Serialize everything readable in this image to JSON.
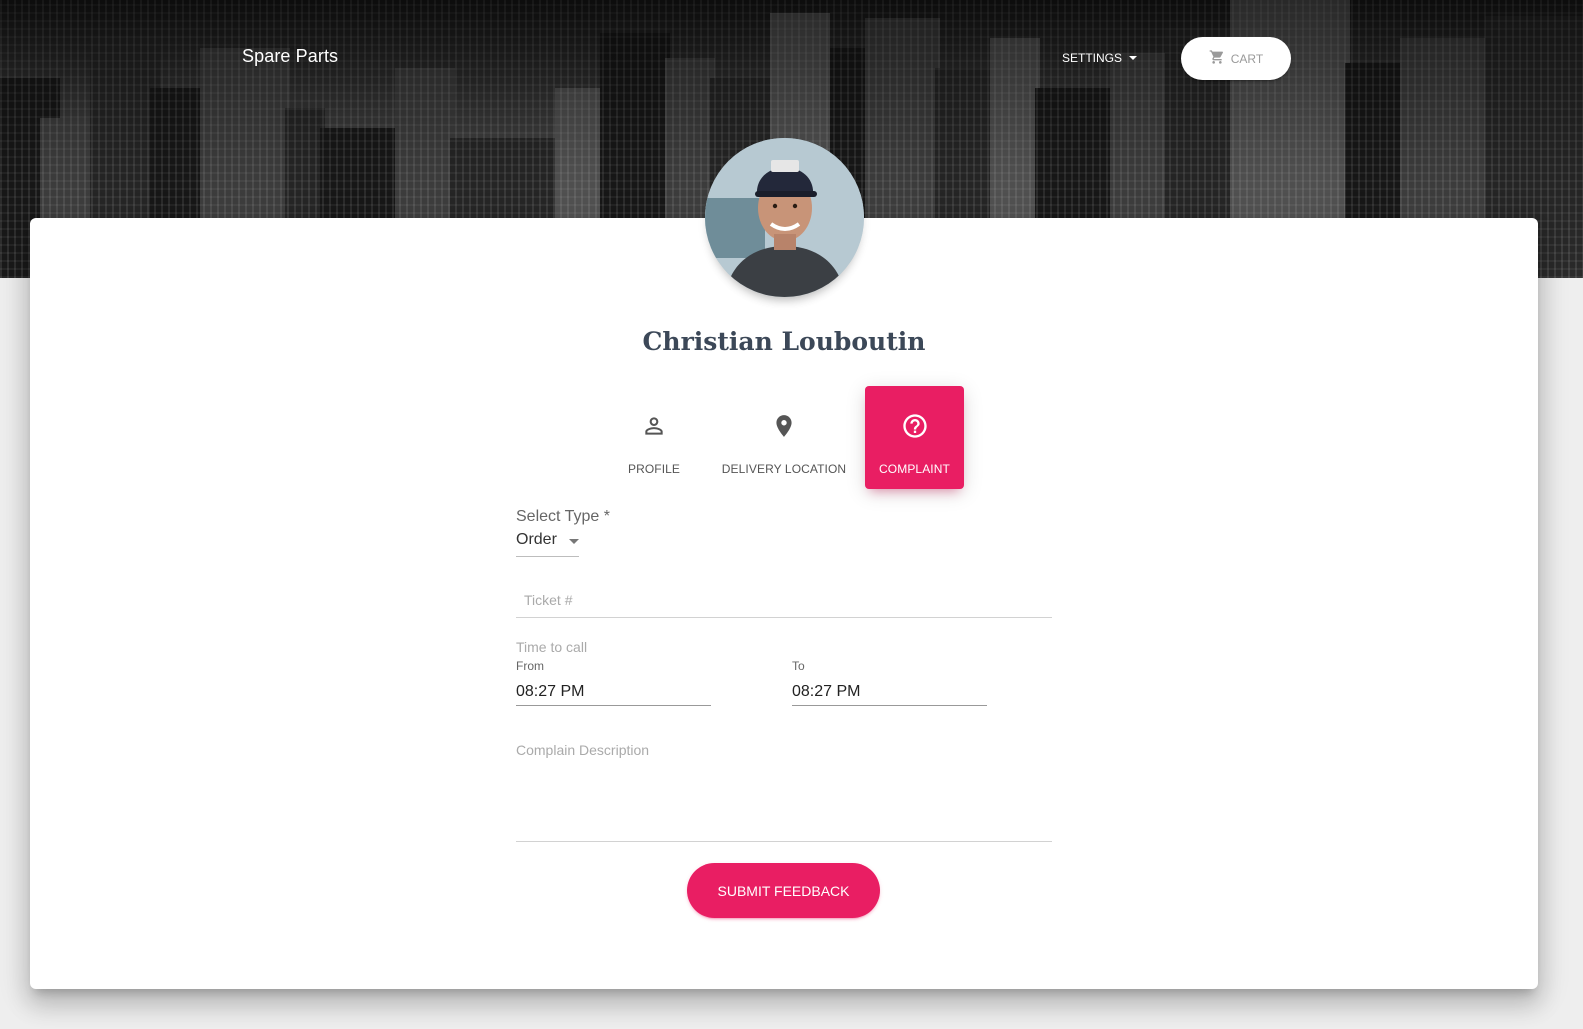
{
  "navbar": {
    "brand": "Spare Parts",
    "settings_label": "SETTINGS",
    "cart_label": "CART"
  },
  "profile": {
    "name": "Christian Louboutin"
  },
  "tabs": [
    {
      "label": "PROFILE",
      "icon": "person-icon",
      "active": false
    },
    {
      "label": "DELIVERY LOCATION",
      "icon": "location-pin-icon",
      "active": false
    },
    {
      "label": "COMPLAINT",
      "icon": "help-circle-icon",
      "active": true
    }
  ],
  "form": {
    "select_type_label": "Select Type *",
    "select_type_value": "Order",
    "ticket_placeholder": "Ticket #",
    "time_to_call_label": "Time to call",
    "from_label": "From",
    "from_value": "08:27 PM",
    "to_label": "To",
    "to_value": "08:27 PM",
    "description_placeholder": "Complain Description",
    "submit_label": "SUBMIT FEEDBACK"
  },
  "colors": {
    "accent": "#e91e63",
    "text_dark": "#3c4858",
    "page_bg": "#eeeeee"
  }
}
